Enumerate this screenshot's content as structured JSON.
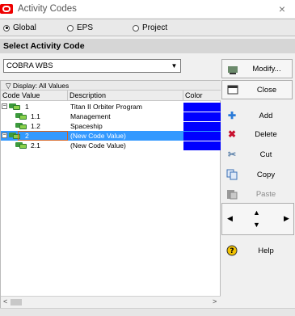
{
  "window": {
    "title": "Activity Codes",
    "close_symbol": "×"
  },
  "scope": {
    "options": [
      {
        "label": "Global",
        "selected": true
      },
      {
        "label": "EPS",
        "selected": false
      },
      {
        "label": "Project",
        "selected": false
      }
    ]
  },
  "panel": {
    "header": "Select Activity Code"
  },
  "code_select": {
    "value": "COBRA WBS",
    "arrow": "▼"
  },
  "grid": {
    "display_label": "▽ Display: All Values",
    "columns": {
      "code": "Code Value",
      "desc": "Description",
      "color": "Color"
    },
    "rows": [
      {
        "code": "1",
        "description": "Titan II Orbiter Program",
        "color": "#0000ff"
      },
      {
        "code": "1.1",
        "description": "Management",
        "color": "#0000ff"
      },
      {
        "code": "1.2",
        "description": "Spaceship",
        "color": "#0000ff"
      },
      {
        "code": "2",
        "description": "(New Code Value)",
        "color": "#0000ff",
        "selected": true
      },
      {
        "code": "2.1",
        "description": "(New Code Value)",
        "color": "#0000ff"
      }
    ],
    "expander_symbol": "−",
    "scroll_left": "<",
    "scroll_right": ">"
  },
  "side_buttons": {
    "modify": "Modify...",
    "close": "Close",
    "add": "Add",
    "delete": "Delete",
    "cut": "Cut",
    "copy": "Copy",
    "paste": "Paste",
    "help": "Help"
  },
  "nav": {
    "up": "▲",
    "down": "▼",
    "left": "◀",
    "right": "▶"
  },
  "icons": {
    "modify": "modify-icon",
    "close": "close-dialog-icon",
    "add": "plus-icon",
    "delete": "delete-x-icon",
    "cut": "scissors-icon",
    "copy": "copy-icon",
    "paste": "paste-icon",
    "help": "help-icon"
  }
}
